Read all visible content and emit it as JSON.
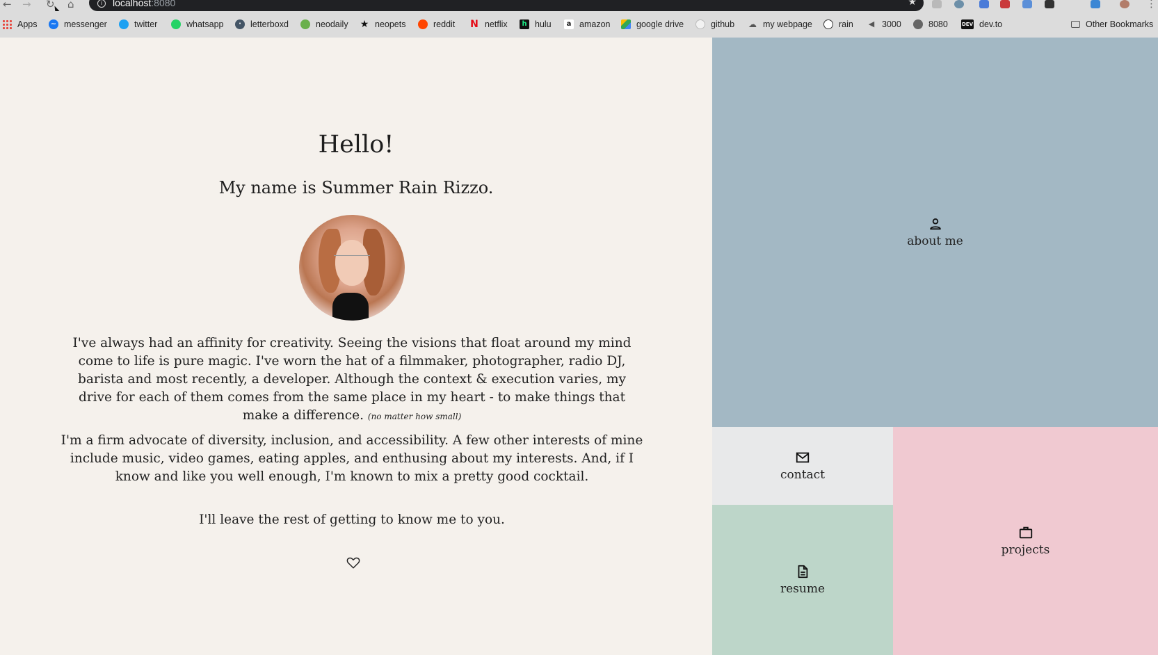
{
  "browser": {
    "url_host": "localhost",
    "url_port": ":8080",
    "bookmarks": [
      {
        "label": "Apps",
        "icon": "apps-grid-icon",
        "color": "#e8453c"
      },
      {
        "label": "messenger",
        "icon": "messenger-icon",
        "color": "#1877f2"
      },
      {
        "label": "twitter",
        "icon": "twitter-icon",
        "color": "#1da1f2"
      },
      {
        "label": "whatsapp",
        "icon": "whatsapp-icon",
        "color": "#25d366"
      },
      {
        "label": "letterboxd",
        "icon": "letterboxd-icon",
        "color": "#445566"
      },
      {
        "label": "neodaily",
        "icon": "neodaily-icon",
        "color": "#6ab04c"
      },
      {
        "label": "neopets",
        "icon": "neopets-star-icon",
        "color": "#111111"
      },
      {
        "label": "reddit",
        "icon": "reddit-icon",
        "color": "#ff4500"
      },
      {
        "label": "netflix",
        "icon": "netflix-icon",
        "color": "#e50914"
      },
      {
        "label": "hulu",
        "icon": "hulu-icon",
        "color": "#111111"
      },
      {
        "label": "amazon",
        "icon": "amazon-icon",
        "color": "#111111"
      },
      {
        "label": "google drive",
        "icon": "google-drive-icon",
        "color": "#34a853"
      },
      {
        "label": "github",
        "icon": "github-icon",
        "color": "#999999"
      },
      {
        "label": "my webpage",
        "icon": "cloud-rain-icon",
        "color": "#555555"
      },
      {
        "label": "rain",
        "icon": "rain-drop-icon",
        "color": "#333333"
      },
      {
        "label": "3000",
        "icon": "speaker-icon",
        "color": "#555555"
      },
      {
        "label": "8080",
        "icon": "globe-icon",
        "color": "#666666"
      },
      {
        "label": "dev.to",
        "icon": "dev-to-icon",
        "color": "#111111"
      },
      {
        "label": "Other Bookmarks",
        "icon": "folder-icon",
        "color": "#555555"
      }
    ]
  },
  "intro": {
    "greeting": "Hello!",
    "name_line": "My name is Summer Rain Rizzo.",
    "paragraph1": "I've always had an affinity for creativity. Seeing the visions that float around my mind come to life is pure magic. I've worn the hat of a filmmaker, photographer, radio DJ, barista and most recently, a developer. Although the context & execution varies, my drive for each of them comes from the same place in my heart - to make things that make a difference.",
    "paragraph1_aside": "(no matter how small)",
    "paragraph2": "I'm a firm advocate of diversity, inclusion, and accessibility. A few other interests of mine include music, video games, eating apples, and enthusing about my interests. And, if I know and like you well enough, I'm known to mix a pretty good cocktail.",
    "paragraph3": "I'll leave the rest of getting to know me to you."
  },
  "nav": {
    "about": {
      "label": "about me",
      "icon": "person-icon",
      "color": "#a3b8c4"
    },
    "contact": {
      "label": "contact",
      "icon": "envelope-icon",
      "color": "#e8e9ea"
    },
    "resume": {
      "label": "resume",
      "icon": "document-icon",
      "color": "#bdd6c9"
    },
    "projects": {
      "label": "projects",
      "icon": "briefcase-icon",
      "color": "#f0c9d1"
    }
  }
}
